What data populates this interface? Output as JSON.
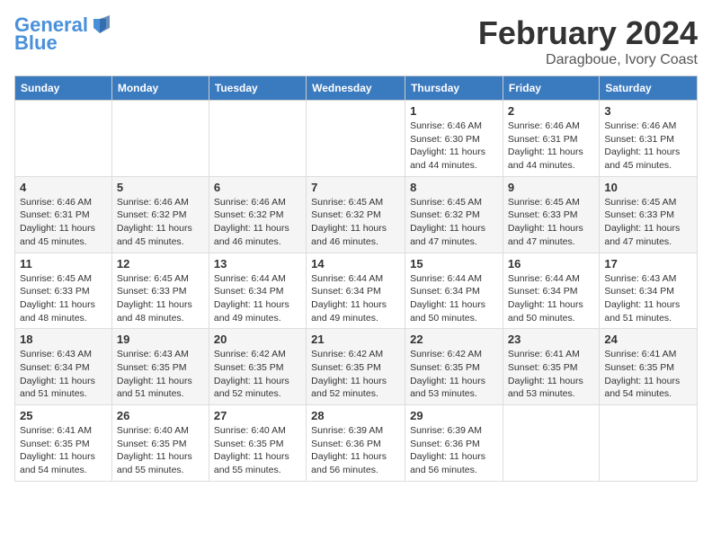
{
  "logo": {
    "line1": "General",
    "line2": "Blue"
  },
  "title": "February 2024",
  "subtitle": "Daragboue, Ivory Coast",
  "headers": [
    "Sunday",
    "Monday",
    "Tuesday",
    "Wednesday",
    "Thursday",
    "Friday",
    "Saturday"
  ],
  "weeks": [
    [
      {
        "day": "",
        "info": ""
      },
      {
        "day": "",
        "info": ""
      },
      {
        "day": "",
        "info": ""
      },
      {
        "day": "",
        "info": ""
      },
      {
        "day": "1",
        "info": "Sunrise: 6:46 AM\nSunset: 6:30 PM\nDaylight: 11 hours\nand 44 minutes."
      },
      {
        "day": "2",
        "info": "Sunrise: 6:46 AM\nSunset: 6:31 PM\nDaylight: 11 hours\nand 44 minutes."
      },
      {
        "day": "3",
        "info": "Sunrise: 6:46 AM\nSunset: 6:31 PM\nDaylight: 11 hours\nand 45 minutes."
      }
    ],
    [
      {
        "day": "4",
        "info": "Sunrise: 6:46 AM\nSunset: 6:31 PM\nDaylight: 11 hours\nand 45 minutes."
      },
      {
        "day": "5",
        "info": "Sunrise: 6:46 AM\nSunset: 6:32 PM\nDaylight: 11 hours\nand 45 minutes."
      },
      {
        "day": "6",
        "info": "Sunrise: 6:46 AM\nSunset: 6:32 PM\nDaylight: 11 hours\nand 46 minutes."
      },
      {
        "day": "7",
        "info": "Sunrise: 6:45 AM\nSunset: 6:32 PM\nDaylight: 11 hours\nand 46 minutes."
      },
      {
        "day": "8",
        "info": "Sunrise: 6:45 AM\nSunset: 6:32 PM\nDaylight: 11 hours\nand 47 minutes."
      },
      {
        "day": "9",
        "info": "Sunrise: 6:45 AM\nSunset: 6:33 PM\nDaylight: 11 hours\nand 47 minutes."
      },
      {
        "day": "10",
        "info": "Sunrise: 6:45 AM\nSunset: 6:33 PM\nDaylight: 11 hours\nand 47 minutes."
      }
    ],
    [
      {
        "day": "11",
        "info": "Sunrise: 6:45 AM\nSunset: 6:33 PM\nDaylight: 11 hours\nand 48 minutes."
      },
      {
        "day": "12",
        "info": "Sunrise: 6:45 AM\nSunset: 6:33 PM\nDaylight: 11 hours\nand 48 minutes."
      },
      {
        "day": "13",
        "info": "Sunrise: 6:44 AM\nSunset: 6:34 PM\nDaylight: 11 hours\nand 49 minutes."
      },
      {
        "day": "14",
        "info": "Sunrise: 6:44 AM\nSunset: 6:34 PM\nDaylight: 11 hours\nand 49 minutes."
      },
      {
        "day": "15",
        "info": "Sunrise: 6:44 AM\nSunset: 6:34 PM\nDaylight: 11 hours\nand 50 minutes."
      },
      {
        "day": "16",
        "info": "Sunrise: 6:44 AM\nSunset: 6:34 PM\nDaylight: 11 hours\nand 50 minutes."
      },
      {
        "day": "17",
        "info": "Sunrise: 6:43 AM\nSunset: 6:34 PM\nDaylight: 11 hours\nand 51 minutes."
      }
    ],
    [
      {
        "day": "18",
        "info": "Sunrise: 6:43 AM\nSunset: 6:34 PM\nDaylight: 11 hours\nand 51 minutes."
      },
      {
        "day": "19",
        "info": "Sunrise: 6:43 AM\nSunset: 6:35 PM\nDaylight: 11 hours\nand 51 minutes."
      },
      {
        "day": "20",
        "info": "Sunrise: 6:42 AM\nSunset: 6:35 PM\nDaylight: 11 hours\nand 52 minutes."
      },
      {
        "day": "21",
        "info": "Sunrise: 6:42 AM\nSunset: 6:35 PM\nDaylight: 11 hours\nand 52 minutes."
      },
      {
        "day": "22",
        "info": "Sunrise: 6:42 AM\nSunset: 6:35 PM\nDaylight: 11 hours\nand 53 minutes."
      },
      {
        "day": "23",
        "info": "Sunrise: 6:41 AM\nSunset: 6:35 PM\nDaylight: 11 hours\nand 53 minutes."
      },
      {
        "day": "24",
        "info": "Sunrise: 6:41 AM\nSunset: 6:35 PM\nDaylight: 11 hours\nand 54 minutes."
      }
    ],
    [
      {
        "day": "25",
        "info": "Sunrise: 6:41 AM\nSunset: 6:35 PM\nDaylight: 11 hours\nand 54 minutes."
      },
      {
        "day": "26",
        "info": "Sunrise: 6:40 AM\nSunset: 6:35 PM\nDaylight: 11 hours\nand 55 minutes."
      },
      {
        "day": "27",
        "info": "Sunrise: 6:40 AM\nSunset: 6:35 PM\nDaylight: 11 hours\nand 55 minutes."
      },
      {
        "day": "28",
        "info": "Sunrise: 6:39 AM\nSunset: 6:36 PM\nDaylight: 11 hours\nand 56 minutes."
      },
      {
        "day": "29",
        "info": "Sunrise: 6:39 AM\nSunset: 6:36 PM\nDaylight: 11 hours\nand 56 minutes."
      },
      {
        "day": "",
        "info": ""
      },
      {
        "day": "",
        "info": ""
      }
    ]
  ]
}
